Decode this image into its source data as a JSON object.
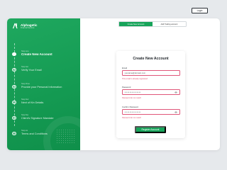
{
  "brand": {
    "name": "Alphagetic",
    "tagline": "Financial Services"
  },
  "steps": [
    {
      "num": "Step one",
      "title": "Create New Account",
      "active": true
    },
    {
      "num": "Step two",
      "title": "Verify Your Email",
      "active": false
    },
    {
      "num": "Step three",
      "title": "Provide your Personal Information",
      "active": false
    },
    {
      "num": "Step four",
      "title": "Next of Kin Details",
      "active": false
    },
    {
      "num": "Step five",
      "title": "Client's Signature Mandate",
      "active": false
    },
    {
      "num": "Step six",
      "title": "Terms and Conditions",
      "active": false
    }
  ],
  "header": {
    "login_label": "Login"
  },
  "tabs": [
    {
      "label": "Create New Account",
      "active": true
    },
    {
      "label": "Add Trading account",
      "active": false
    }
  ],
  "form": {
    "title": "Create New Account",
    "email": {
      "label": "Email",
      "value": "youname@domain.com",
      "error": "This email is already registered"
    },
    "password": {
      "label": "Password",
      "value": "••••••••••••••••",
      "error": "Password do not match"
    },
    "confirm_password": {
      "label": "Confirm Password",
      "value": "••••••••••••••••",
      "error": "Password do not match"
    },
    "submit_label": "Register Account"
  },
  "colors": {
    "brand_green": "#17a45a",
    "error_red": "#e0506e",
    "background": "#e6e9ec"
  }
}
